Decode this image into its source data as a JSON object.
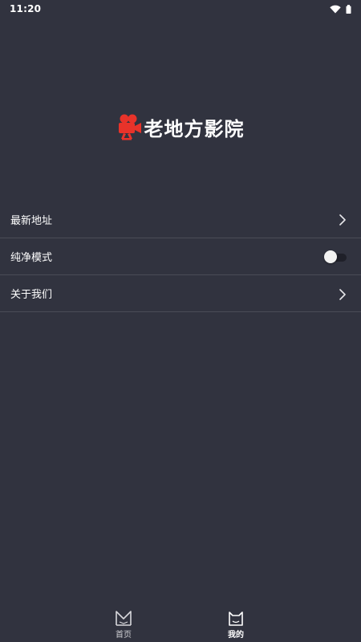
{
  "status_bar": {
    "time": "11:20",
    "icons": [
      "wifi-icon",
      "battery-icon"
    ]
  },
  "app": {
    "title": "老地方影院",
    "logo_icon": "movie-camera-icon",
    "logo_color": "#e8332a"
  },
  "menu": {
    "items": [
      {
        "label": "最新地址",
        "control": "chevron-right-icon"
      },
      {
        "label": "纯净模式",
        "control": "toggle-switch",
        "toggle_on": false
      },
      {
        "label": "关于我们",
        "control": "chevron-right-icon"
      }
    ]
  },
  "bottom_nav": {
    "items": [
      {
        "label": "首页",
        "icon": "home-m-icon",
        "active": false
      },
      {
        "label": "我的",
        "icon": "profile-cat-icon",
        "active": true
      }
    ]
  },
  "colors": {
    "background": "#31333f",
    "divider": "#4a4c57",
    "text": "#ffffff"
  }
}
